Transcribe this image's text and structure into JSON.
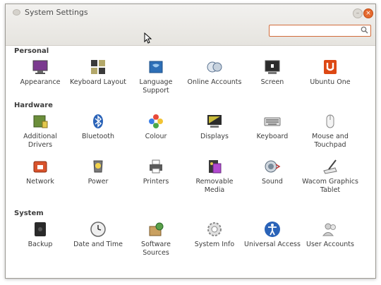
{
  "window": {
    "title": "System Settings"
  },
  "search": {
    "placeholder": ""
  },
  "sections": {
    "personal": {
      "title": "Personal",
      "items": [
        {
          "label": "Appearance",
          "icon": "appearance-icon"
        },
        {
          "label": "Keyboard Layout",
          "icon": "keyboard-layout-icon"
        },
        {
          "label": "Language Support",
          "icon": "language-support-icon"
        },
        {
          "label": "Online Accounts",
          "icon": "online-accounts-icon"
        },
        {
          "label": "Screen",
          "icon": "screen-icon"
        },
        {
          "label": "Ubuntu One",
          "icon": "ubuntu-one-icon"
        }
      ]
    },
    "hardware": {
      "title": "Hardware",
      "items": [
        {
          "label": "Additional Drivers",
          "icon": "additional-drivers-icon"
        },
        {
          "label": "Bluetooth",
          "icon": "bluetooth-icon"
        },
        {
          "label": "Colour",
          "icon": "colour-icon"
        },
        {
          "label": "Displays",
          "icon": "displays-icon"
        },
        {
          "label": "Keyboard",
          "icon": "keyboard-icon"
        },
        {
          "label": "Mouse and Touchpad",
          "icon": "mouse-icon"
        },
        {
          "label": "Network",
          "icon": "network-icon"
        },
        {
          "label": "Power",
          "icon": "power-icon"
        },
        {
          "label": "Printers",
          "icon": "printer-icon"
        },
        {
          "label": "Removable Media",
          "icon": "removable-media-icon"
        },
        {
          "label": "Sound",
          "icon": "sound-icon"
        },
        {
          "label": "Wacom Graphics Tablet",
          "icon": "wacom-tablet-icon"
        }
      ]
    },
    "system": {
      "title": "System",
      "items": [
        {
          "label": "Backup",
          "icon": "backup-icon"
        },
        {
          "label": "Date and Time",
          "icon": "clock-icon"
        },
        {
          "label": "Software Sources",
          "icon": "software-sources-icon"
        },
        {
          "label": "System Info",
          "icon": "system-info-icon"
        },
        {
          "label": "Universal Access",
          "icon": "universal-access-icon"
        },
        {
          "label": "User Accounts",
          "icon": "user-accounts-icon"
        }
      ]
    }
  },
  "colors": {
    "accent": "#e56a2f",
    "text": "#3c3c3c"
  }
}
